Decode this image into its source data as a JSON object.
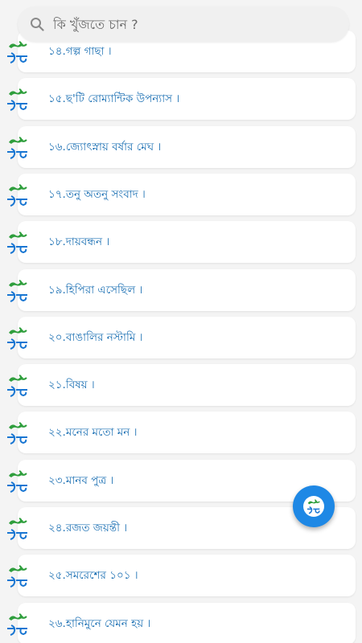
{
  "search": {
    "placeholder": "কি খুঁজতে চান ?"
  },
  "brand": {
    "accent": "#1e88e5",
    "logo_green": "#2e9e3c",
    "logo_blue": "#1976d2",
    "logo_icon": "boi-tong-logo-icon"
  },
  "items": [
    {
      "label": "১৪.গল্প গাছা ।"
    },
    {
      "label": "১৫.ছ'টি রোম্যান্টিক উপন্যাস ।"
    },
    {
      "label": "১৬.জ্যোৎস্নায় বর্ষার মেঘ ।"
    },
    {
      "label": "১৭.তনু অতনু সংবাদ ।"
    },
    {
      "label": "১৮.দায়বন্ধন ।"
    },
    {
      "label": "১৯.হিপিরা এসেছিল ।"
    },
    {
      "label": "২০.বাঙালির নস্টামি ।"
    },
    {
      "label": "২১.বিষয় ।"
    },
    {
      "label": "২২.মনের মতো মন ।"
    },
    {
      "label": "২৩.মানব পুত্র ।"
    },
    {
      "label": "২৪.রজত জয়ন্তী ।"
    },
    {
      "label": "২৫.সমরেশের ১০১ ।"
    },
    {
      "label": "২৬.হানিমুনে যেমন হয় ।"
    }
  ]
}
